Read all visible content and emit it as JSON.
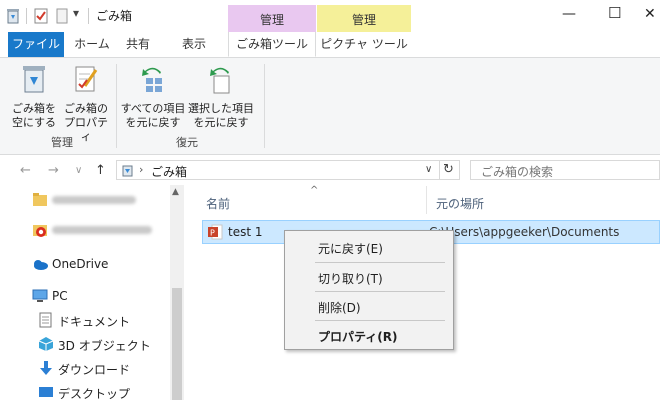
{
  "titlebar": {
    "title": "ごみ箱",
    "context_manage_1": "管理",
    "context_manage_2": "管理",
    "minimize": "—",
    "maximize": "☐",
    "close": "✕"
  },
  "tabs": {
    "file": "ファイル",
    "home": "ホーム",
    "share": "共有",
    "view": "表示",
    "recycle_tools": "ごみ箱ツール",
    "picture_tools": "ピクチャ ツール"
  },
  "ribbon": {
    "empty_line1": "ごみ箱を",
    "empty_line2": "空にする",
    "props_line1": "ごみ箱の",
    "props_line2": "プロパティ",
    "group_manage": "管理",
    "restore_all_line1": "すべての項目",
    "restore_all_line2": "を元に戻す",
    "restore_sel_line1": "選択した項目",
    "restore_sel_line2": "を元に戻す",
    "group_restore": "復元"
  },
  "address": {
    "back": "←",
    "forward": "→",
    "dropdown": "∨",
    "up": "↑",
    "path": "ごみ箱",
    "path_dropdown": "∨",
    "refresh": "↻",
    "search_placeholder": "ごみ箱の検索"
  },
  "navpane": {
    "items": [
      {
        "label": ""
      },
      {
        "label": ""
      },
      {
        "label": "OneDrive"
      },
      {
        "label": "PC"
      },
      {
        "label": "ドキュメント"
      },
      {
        "label": "3D オブジェクト"
      },
      {
        "label": "ダウンロード"
      },
      {
        "label": "デスクトップ"
      }
    ]
  },
  "filelist": {
    "col_name": "名前",
    "col_location": "元の場所",
    "sort_indicator": "^",
    "rows": [
      {
        "name": "test 1",
        "location": "C:\\Users\\appgeeker\\Documents"
      }
    ]
  },
  "contextmenu": {
    "restore": "元に戻す(E)",
    "cut": "切り取り(T)",
    "delete": "削除(D)",
    "properties": "プロパティ(R)"
  },
  "colors": {
    "file_tab": "#1979ca",
    "manage_context_1": "#e9c8f0",
    "manage_context_2": "#f5f099",
    "selection": "#cce8ff"
  }
}
